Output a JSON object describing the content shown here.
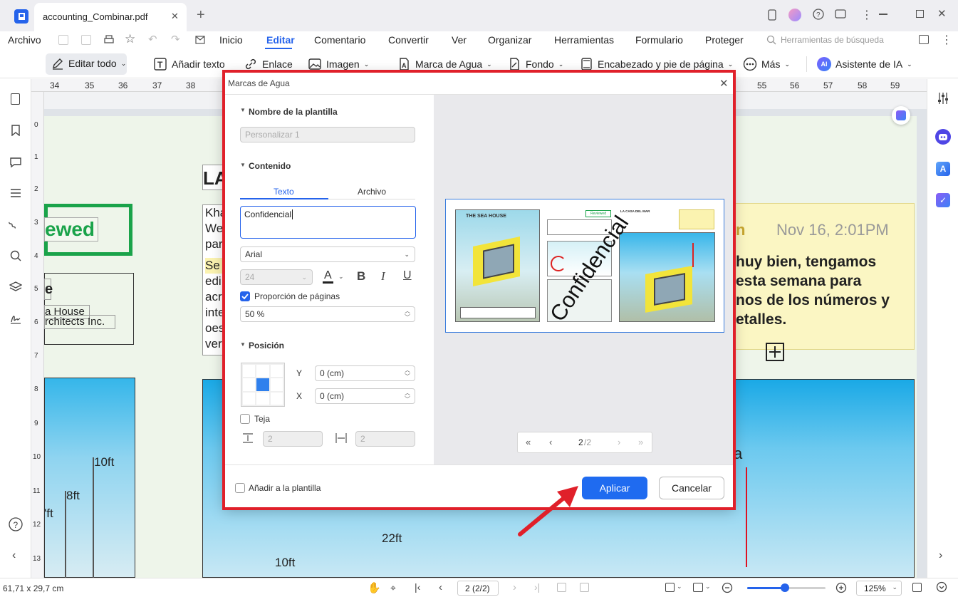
{
  "app": {
    "tab_title": "accounting_Combinar.pdf",
    "tab_close": "✕",
    "new_tab": "+"
  },
  "menu": {
    "archivo": "Archivo",
    "items": [
      "Inicio",
      "Editar",
      "Comentario",
      "Convertir",
      "Ver",
      "Organizar",
      "Herramientas",
      "Formulario",
      "Proteger"
    ],
    "active": "Editar",
    "search_placeholder": "Herramientas de búsqueda"
  },
  "toolbar": {
    "edit_all": "Editar todo",
    "add_text": "Añadir texto",
    "link": "Enlace",
    "image": "Imagen",
    "watermark": "Marca de Agua",
    "background": "Fondo",
    "header_footer": "Encabezado y pie de página",
    "more": "Más",
    "ai_assistant": "Asistente de IA",
    "ai_badge": "AI"
  },
  "ruler_top": [
    "34",
    "35",
    "36",
    "37",
    "38",
    "55",
    "56",
    "57",
    "58",
    "59"
  ],
  "ruler_left": [
    "0",
    "1",
    "2",
    "3",
    "4",
    "5",
    "6",
    "7",
    "8",
    "9",
    "10",
    "11",
    "12",
    "13"
  ],
  "document": {
    "reviewed": "ewed",
    "title_frag": "LA",
    "e_frag": "e",
    "sea_house": "a House",
    "architects": "rchitects Inc.",
    "para1": [
      "Kha",
      "We",
      "par"
    ],
    "para2": [
      "Se",
      "edi",
      "acr",
      "inte",
      "oes",
      "ver"
    ],
    "note_name": "n",
    "note_date": "Nov 16, 2:01PM",
    "note_lines": [
      "huy bien, tengamos",
      "esta semana para",
      "nos de los números y",
      "etalles."
    ],
    "ft10": "10ft",
    "ft8": "8ft",
    "ft_frag": "'ft",
    "ft22": "22ft",
    "ft10b": "10ft",
    "a_frag": "a"
  },
  "dialog": {
    "title": "Marcas de Agua",
    "template_name_label": "Nombre de la plantilla",
    "template_name_value": "Personalizar 1",
    "content_label": "Contenido",
    "tab_text": "Texto",
    "tab_file": "Archivo",
    "text_value": "Confidencial",
    "font": "Arial",
    "font_size": "24",
    "page_ratio_label": "Proporción de páginas",
    "page_ratio_value": "50 %",
    "position_label": "Posición",
    "y_label": "Y",
    "y_value": "0 (cm)",
    "x_label": "X",
    "x_value": "0 (cm)",
    "tile_label": "Teja",
    "tile_v": "2",
    "tile_h": "2",
    "preview_watermark": "Confidencial",
    "preview_sea_house": "THE SEA HOUSE",
    "preview_casa": "LA CASA DEL MAR",
    "preview_reviewed": "Reviewed",
    "page_current": "2",
    "page_total": "/2",
    "add_to_template": "Añadir a la plantilla",
    "apply": "Aplicar",
    "cancel": "Cancelar"
  },
  "status": {
    "dimensions": "61,71 x 29,7 cm",
    "page_indicator": "2 (2/2)",
    "zoom": "125%",
    "zoom_fraction": 0.48
  },
  "colors": {
    "accent": "#2563eb",
    "highlight": "#e0202a",
    "green": "#1aa34a",
    "note": "#fbf6c3"
  }
}
